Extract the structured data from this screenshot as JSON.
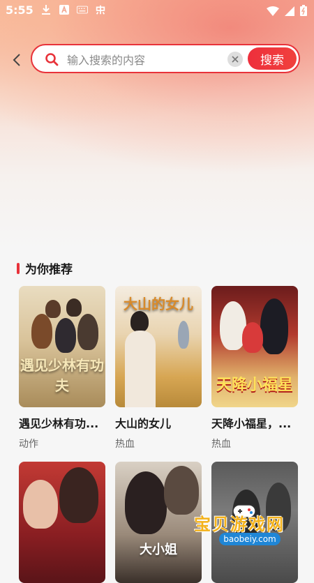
{
  "status_bar": {
    "time": "5:55",
    "icons": [
      "download-icon",
      "a-icon",
      "keyboard-icon",
      "app-icon"
    ],
    "right_icons": [
      "wifi-icon",
      "signal-icon",
      "battery-icon"
    ]
  },
  "search": {
    "placeholder": "输入搜索的内容",
    "value": "",
    "button_label": "搜索"
  },
  "recommend": {
    "title": "为你推荐",
    "items": [
      {
        "title": "遇见少林有功...",
        "tag": "动作",
        "poster_text": "遇见少林有功夫"
      },
      {
        "title": "大山的女儿",
        "tag": "热血",
        "poster_text": "大山的女儿"
      },
      {
        "title": "天降小福星，...",
        "tag": "热血",
        "poster_text": "天降小福星"
      },
      {
        "title": "",
        "tag": "",
        "poster_text": ""
      },
      {
        "title": "",
        "tag": "",
        "poster_text": "大小姐"
      },
      {
        "title": "",
        "tag": "",
        "poster_text": ""
      }
    ]
  },
  "watermark": {
    "text": "宝贝游戏网",
    "url": "baobeiy.com"
  },
  "colors": {
    "accent": "#e8323a",
    "search_button": "#ee2f3c"
  }
}
